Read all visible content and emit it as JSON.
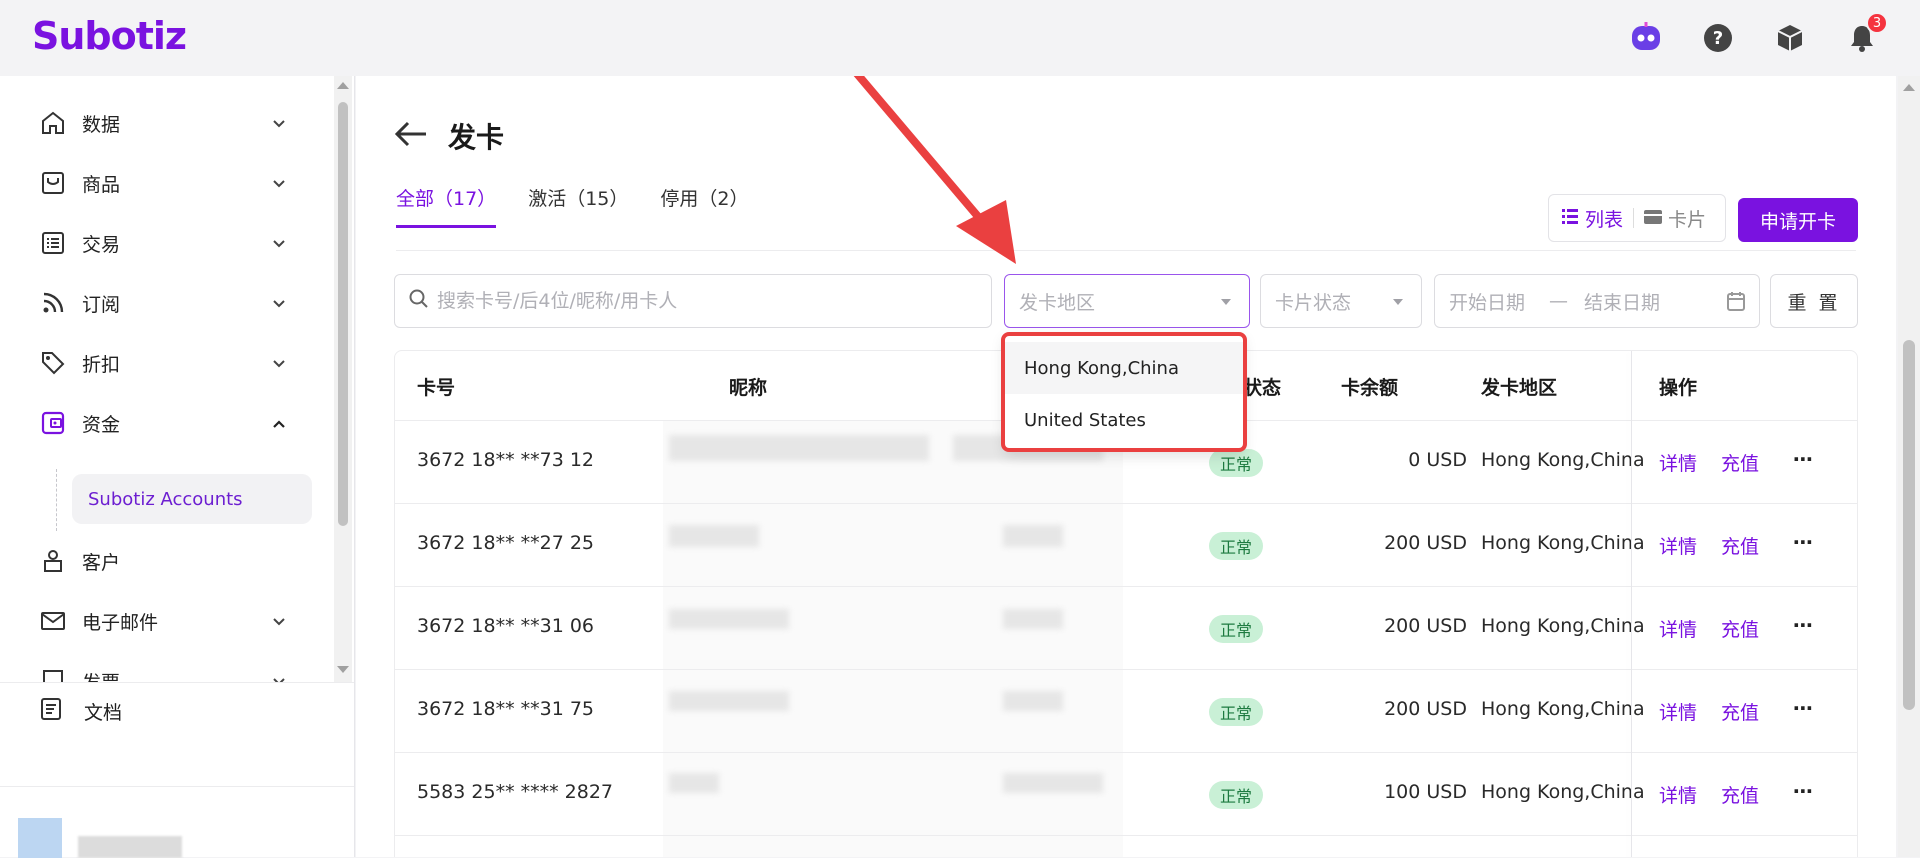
{
  "app": {
    "logo": "Subotiz",
    "notification_count": "3"
  },
  "sidebar": {
    "items": [
      {
        "label": "数据",
        "icon": "home-icon"
      },
      {
        "label": "商品",
        "icon": "store-icon"
      },
      {
        "label": "交易",
        "icon": "list-icon"
      },
      {
        "label": "订阅",
        "icon": "rss-icon"
      },
      {
        "label": "折扣",
        "icon": "tag-icon"
      },
      {
        "label": "资金",
        "icon": "wallet-icon"
      },
      {
        "label": "客户",
        "icon": "user-icon"
      },
      {
        "label": "电子邮件",
        "icon": "mail-icon"
      },
      {
        "label": "发票",
        "icon": "invoice-icon"
      }
    ],
    "sub_item": "Subotiz Accounts",
    "docs": "文档"
  },
  "page": {
    "title": "发卡",
    "tabs": [
      {
        "label": "全部（17）",
        "active": true
      },
      {
        "label": "激活（15）",
        "active": false
      },
      {
        "label": "停用（2）",
        "active": false
      }
    ],
    "view_list": "列表",
    "view_card": "卡片",
    "apply_button": "申请开卡"
  },
  "filters": {
    "search_placeholder": "搜索卡号/后4位/昵称/用卡人",
    "region_placeholder": "发卡地区",
    "status_placeholder": "卡片状态",
    "start_date": "开始日期",
    "date_sep": "—",
    "end_date": "结束日期",
    "reset": "重 置"
  },
  "dropdown": {
    "options": [
      "Hong Kong,China",
      "United States"
    ]
  },
  "table": {
    "headers": {
      "card_no": "卡号",
      "nickname": "昵称",
      "status": "状态",
      "balance": "卡余额",
      "region": "发卡地区",
      "ops": "操作"
    },
    "rows": [
      {
        "card_no": "3672 18** **73 12",
        "status": "正常",
        "balance": "0 USD",
        "region": "Hong Kong,China"
      },
      {
        "card_no": "3672 18** **27 25",
        "status": "正常",
        "balance": "200 USD",
        "region": "Hong Kong,China"
      },
      {
        "card_no": "3672 18** **31 06",
        "status": "正常",
        "balance": "200 USD",
        "region": "Hong Kong,China"
      },
      {
        "card_no": "3672 18** **31 75",
        "status": "正常",
        "balance": "200 USD",
        "region": "Hong Kong,China"
      },
      {
        "card_no": "5583 25** **** 2827",
        "status": "正常",
        "balance": "100 USD",
        "region": "Hong Kong,China"
      }
    ],
    "detail_link": "详情",
    "recharge_link": "充值"
  },
  "colors": {
    "brand": "#7a12e0",
    "annotation_red": "#ea4040",
    "status_green_bg": "#c9f0d6"
  }
}
